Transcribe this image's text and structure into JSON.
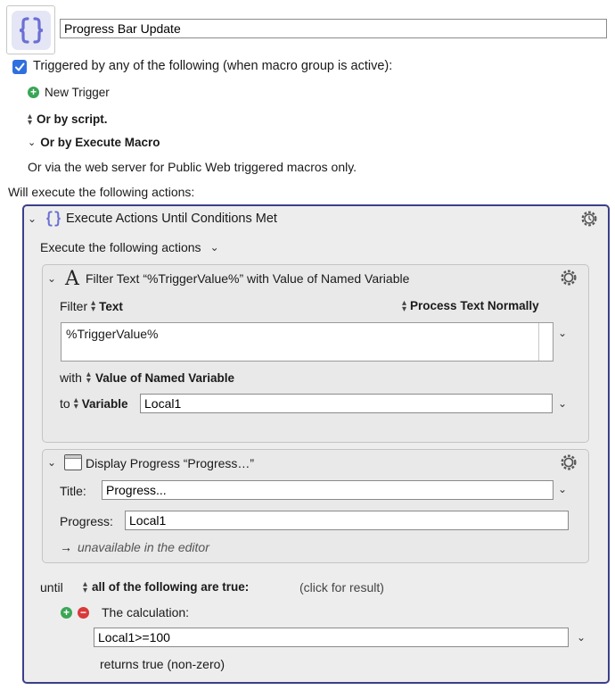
{
  "macro": {
    "name": "Progress Bar Update"
  },
  "triggers": {
    "checkbox_label": "Triggered by any of the following (when macro group is active):",
    "new_trigger_label": "New Trigger",
    "or_by_script_label": "Or by script.",
    "or_by_execute_macro_label": "Or by Execute Macro",
    "web_server_note": "Or via the web server for Public Web triggered macros only."
  },
  "actions": {
    "header": "Will execute the following actions:",
    "until_block": {
      "title": "Execute Actions Until Conditions Met",
      "execute_label": "Execute the following actions",
      "filter_action": {
        "title": "Filter Text “%TriggerValue%” with Value of Named Variable",
        "filter_label": "Filter",
        "filter_type": "Text",
        "process_label": "Process Text Normally",
        "text_value": "%TriggerValue%",
        "with_label": "with",
        "with_value": "Value of Named Variable",
        "to_label": "to",
        "to_type": "Variable",
        "variable_value": "Local1"
      },
      "progress_action": {
        "title": "Display Progress “Progress…”",
        "title_label": "Title:",
        "title_value": "Progress...",
        "progress_label": "Progress:",
        "progress_value": "Local1",
        "unavailable_arrow": "→",
        "unavailable_note": "unavailable in the editor"
      },
      "until_label": "until",
      "condition_mode": "all of the following are true:",
      "click_for_result": "(click for result)",
      "condition": {
        "label": "The calculation:",
        "expression": "Local1>=100",
        "result_note": "returns true (non-zero)"
      }
    }
  },
  "colors": {
    "accent": "#2f6fdf",
    "outer_border": "#3b3f8a",
    "add": "#3aa655",
    "remove": "#d93a3a",
    "icon_purple": "#6b6fd4"
  }
}
